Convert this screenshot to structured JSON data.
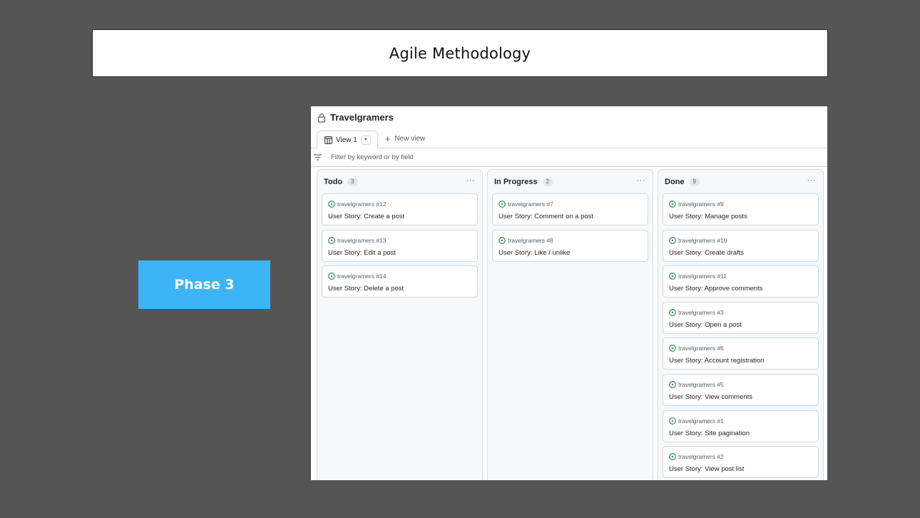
{
  "slide": {
    "title": "Agile Methodology",
    "phase_label": "Phase 3"
  },
  "board": {
    "title": "Travelgramers",
    "views": {
      "active": "View 1",
      "new": "New view"
    },
    "filter_placeholder": "Filter by keyword or by field",
    "columns": [
      {
        "name": "Todo",
        "count": "3",
        "cards": [
          {
            "ref": "travelgramers #12",
            "title": "User Story: Create a post"
          },
          {
            "ref": "travelgramers #13",
            "title": "User Story: Edit a post"
          },
          {
            "ref": "travelgramers #14",
            "title": "User Story: Delete a post"
          }
        ]
      },
      {
        "name": "In Progress",
        "count": "2",
        "cards": [
          {
            "ref": "travelgramers #7",
            "title": "User Story: Comment on a post"
          },
          {
            "ref": "travelgramers #8",
            "title": "User Story: Like / unlike"
          }
        ]
      },
      {
        "name": "Done",
        "count": "9",
        "cards": [
          {
            "ref": "travelgramers #9",
            "title": "User Story: Manage posts"
          },
          {
            "ref": "travelgramers #10",
            "title": "User Story: Create drafts"
          },
          {
            "ref": "travelgramers #11",
            "title": "User Story: Approve comments"
          },
          {
            "ref": "travelgramers #3",
            "title": "User Story: Open a post"
          },
          {
            "ref": "travelgramers #6",
            "title": "User Story: Account registration"
          },
          {
            "ref": "travelgramers #5",
            "title": "User Story: View comments"
          },
          {
            "ref": "travelgramers #1",
            "title": "User Story: Site pagination"
          },
          {
            "ref": "travelgramers #2",
            "title": "User Story: View post list"
          }
        ]
      }
    ]
  },
  "icons": {
    "lock": "lock-icon",
    "board_view": "board-view-icon",
    "caret": "chevron-down-icon",
    "plus": "plus-icon",
    "filter": "filter-icon",
    "more": "more-horizontal-icon",
    "issue_open": "issue-open-icon"
  },
  "colors": {
    "background": "#555555",
    "phase_accent": "#3db4f5",
    "issue_open": "#1a7f37"
  }
}
